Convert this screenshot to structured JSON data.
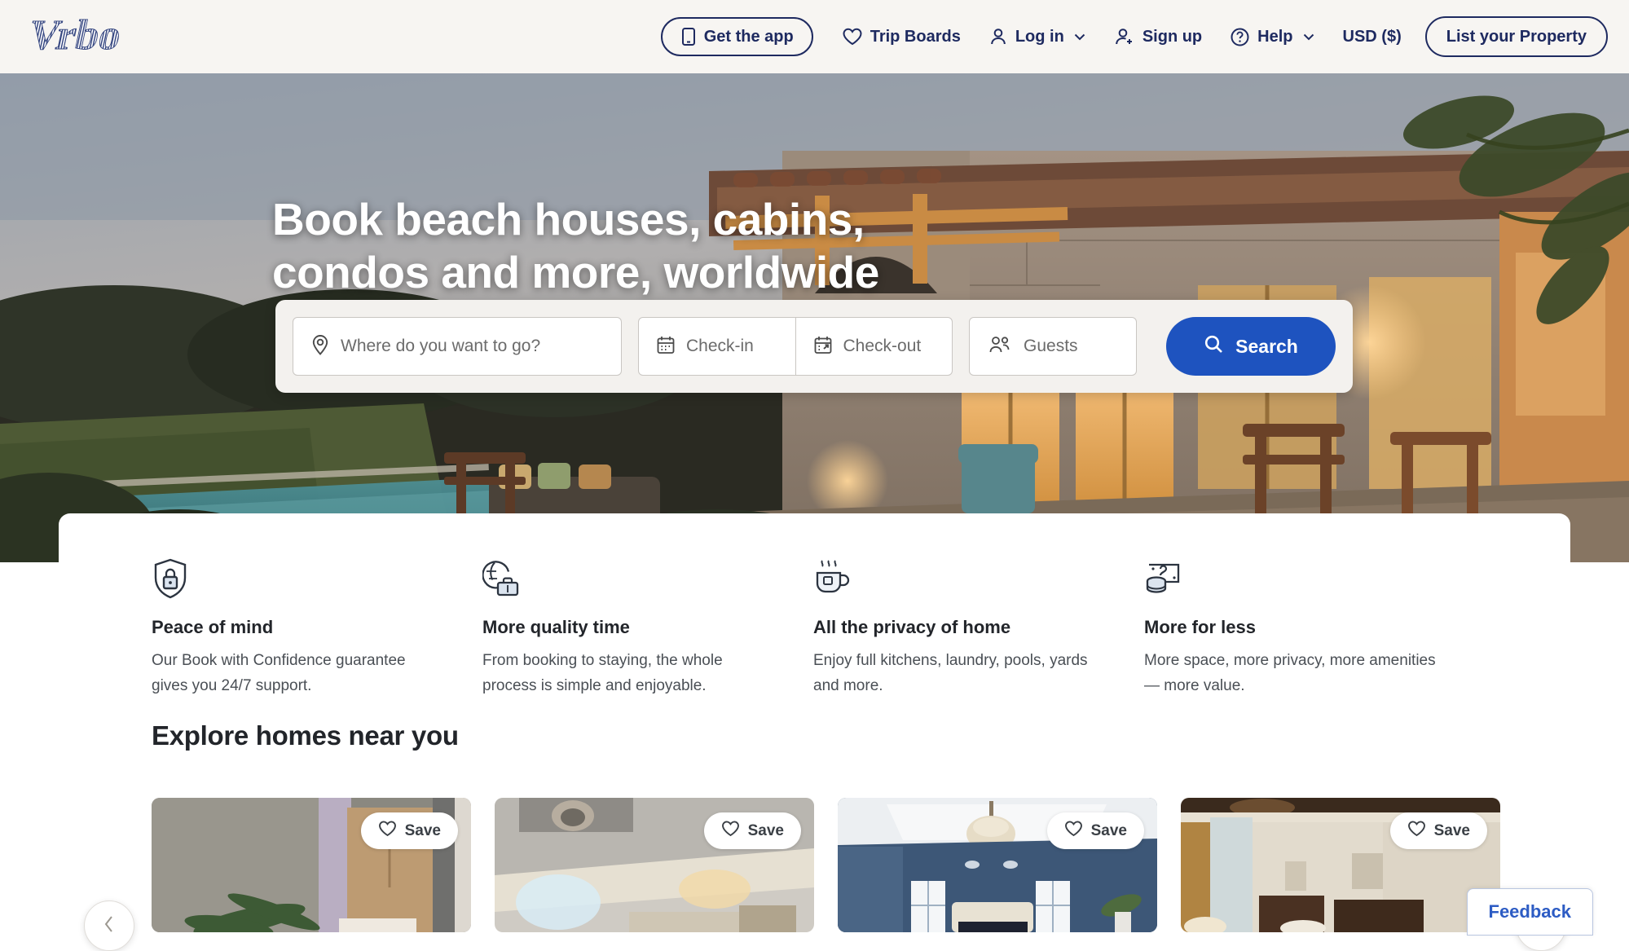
{
  "header": {
    "logo_text": "Vrbo",
    "nav": [
      {
        "label": "Get the app",
        "icon": "mobile-phone-icon",
        "style": "pill"
      },
      {
        "label": "Trip Boards",
        "icon": "heart-icon",
        "style": "plain"
      },
      {
        "label": "Log in",
        "icon": "person-icon",
        "style": "plain",
        "chevron": true
      },
      {
        "label": "Sign up",
        "icon": "person-plus-icon",
        "style": "plain"
      },
      {
        "label": "Help",
        "icon": "question-circle-icon",
        "style": "plain",
        "chevron": true
      },
      {
        "label": "USD ($)",
        "icon": "none",
        "style": "plain"
      },
      {
        "label": "List your Property",
        "icon": "none",
        "style": "pill-cta"
      }
    ]
  },
  "hero": {
    "title_line1": "Book beach houses, cabins,",
    "title_line2": "condos and more, worldwide"
  },
  "search": {
    "destination_placeholder": "Where do you want to go?",
    "checkin_placeholder": "Check-in",
    "checkout_placeholder": "Check-out",
    "guests_placeholder": "Guests",
    "search_label": "Search",
    "accent_color": "#1e53bf"
  },
  "features": [
    {
      "icon": "shield-lock-icon",
      "title": "Peace of mind",
      "desc": "Our Book with Confidence guarantee gives you 24/7 support."
    },
    {
      "icon": "globe-suitcase-icon",
      "title": "More quality time",
      "desc": "From booking to staying, the whole process is simple and enjoyable."
    },
    {
      "icon": "coffee-cup-icon",
      "title": "All the privacy of home",
      "desc": "Enjoy full kitchens, laundry, pools, yards and more."
    },
    {
      "icon": "money-coins-icon",
      "title": "More for less",
      "desc": "More space, more privacy, more amenities — more value."
    }
  ],
  "explore": {
    "section_title": "Explore homes near you",
    "save_label": "Save",
    "cards": [
      {
        "image_alt": "bedroom-with-plant",
        "save_label": "Save"
      },
      {
        "image_alt": "ceiling-with-recessed-lights",
        "save_label": "Save"
      },
      {
        "image_alt": "navy-blue-bedroom-with-chandelier",
        "save_label": "Save"
      },
      {
        "image_alt": "living-room-interior",
        "save_label": "Save"
      }
    ]
  },
  "feedback": {
    "label": "Feedback"
  },
  "colors": {
    "brand_navy": "#1e2a60",
    "header_bg": "#f7f5f2",
    "search_blue": "#1e53bf"
  }
}
